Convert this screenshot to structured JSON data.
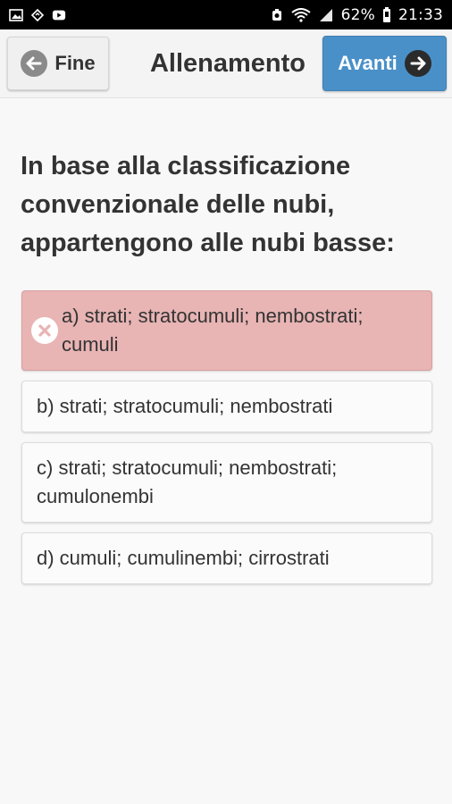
{
  "status_bar": {
    "battery": "62%",
    "time": "21:33",
    "icons": [
      "image-icon",
      "sync-icon",
      "youtube-icon",
      "alarm-icon",
      "wifi-icon",
      "signal-icon",
      "battery-icon"
    ]
  },
  "header": {
    "back_label": "Fine",
    "title": "Allenamento",
    "next_label": "Avanti",
    "next_color": "#4a90c8"
  },
  "question": {
    "text": "In base alla classificazione convenzionale delle nubi, appartengono alle nubi basse:"
  },
  "answers": [
    {
      "text": "a) strati; stratocumuli; nembostrati; cumuli",
      "state": "wrong",
      "color": "#e8b4b4"
    },
    {
      "text": "b) strati; stratocumuli; nembostrati",
      "state": "neutral"
    },
    {
      "text": "c) strati; stratocumuli; nembostrati; cumulonembi",
      "state": "neutral"
    },
    {
      "text": "d) cumuli; cumulinembi; cirrostrati",
      "state": "neutral"
    }
  ]
}
